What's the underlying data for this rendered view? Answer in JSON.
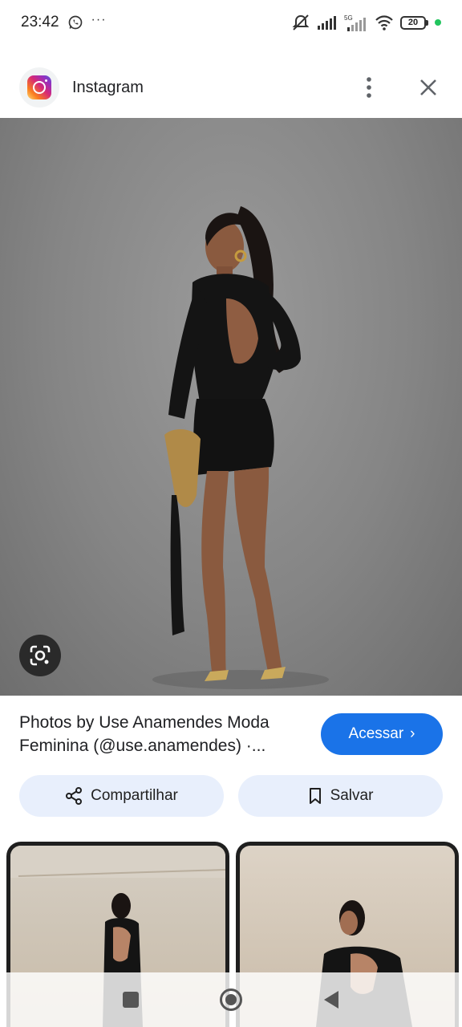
{
  "status_bar": {
    "time": "23:42",
    "overflow": "···",
    "network": "5G",
    "battery": "20"
  },
  "header": {
    "source_name": "Instagram",
    "icons": {
      "logo": "instagram-logo",
      "more": "more-vert-icon",
      "close": "close-icon"
    }
  },
  "main_image": {
    "lens_icon": "lens-search-icon"
  },
  "info": {
    "title": "Photos by Use Anamendes Moda Feminina (@use.anamendes) ·...",
    "visit_label": "Acessar",
    "visit_chevron": "›"
  },
  "actions": {
    "share_label": "Compartilhar",
    "save_label": "Salvar"
  },
  "colors": {
    "accent": "#1a73e8",
    "pill_bg": "#e8effc",
    "image_bg": "#858585"
  }
}
